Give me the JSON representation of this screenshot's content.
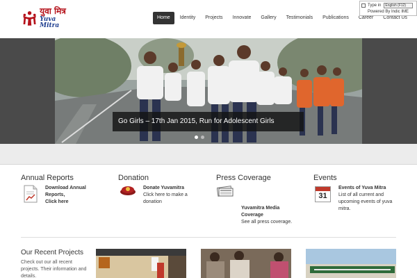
{
  "brand": {
    "name_hindi": "युवा मित्र",
    "name_english": "Yuva Mitra",
    "color_red": "#b5121b",
    "color_blue": "#1d3d8f"
  },
  "nav": {
    "items": [
      {
        "label": "Home",
        "active": true
      },
      {
        "label": "Identity"
      },
      {
        "label": "Projects"
      },
      {
        "label": "Innovate"
      },
      {
        "label": "Gallery"
      },
      {
        "label": "Testimonials"
      },
      {
        "label": "Publications"
      },
      {
        "label": "Career"
      },
      {
        "label": "Contact Us"
      }
    ]
  },
  "ime": {
    "type_in_label": "Type in",
    "selected_option": "English (F12)",
    "powered_by": "Powered By Indic IME"
  },
  "hero": {
    "caption": "Go Girls – 17th Jan 2015, Run for Adolescent Girls",
    "slide_count": 2,
    "active_slide": 1
  },
  "features": [
    {
      "title": "Annual Reports",
      "link": "Download Annual Reports,",
      "text": "Click here",
      "icon": "report-document-icon"
    },
    {
      "title": "Donation",
      "link": "Donate  Yuvamitra",
      "text": "Click here to make a donation",
      "icon": "donation-icon"
    },
    {
      "title": "Press Coverage",
      "link": "Yuvamitra Media Coverage",
      "text": "See all press coverage.",
      "icon": "newspaper-icon"
    },
    {
      "title": "Events",
      "link": "Events of Yuva Mitra",
      "text": "List of all current and upcoming events  of yuva mitra.",
      "icon": "calendar-icon",
      "calendar_day": "31"
    }
  ],
  "recent": {
    "title": "Our Recent Projects",
    "description": "Check out our all recent projects. Their information and details."
  }
}
